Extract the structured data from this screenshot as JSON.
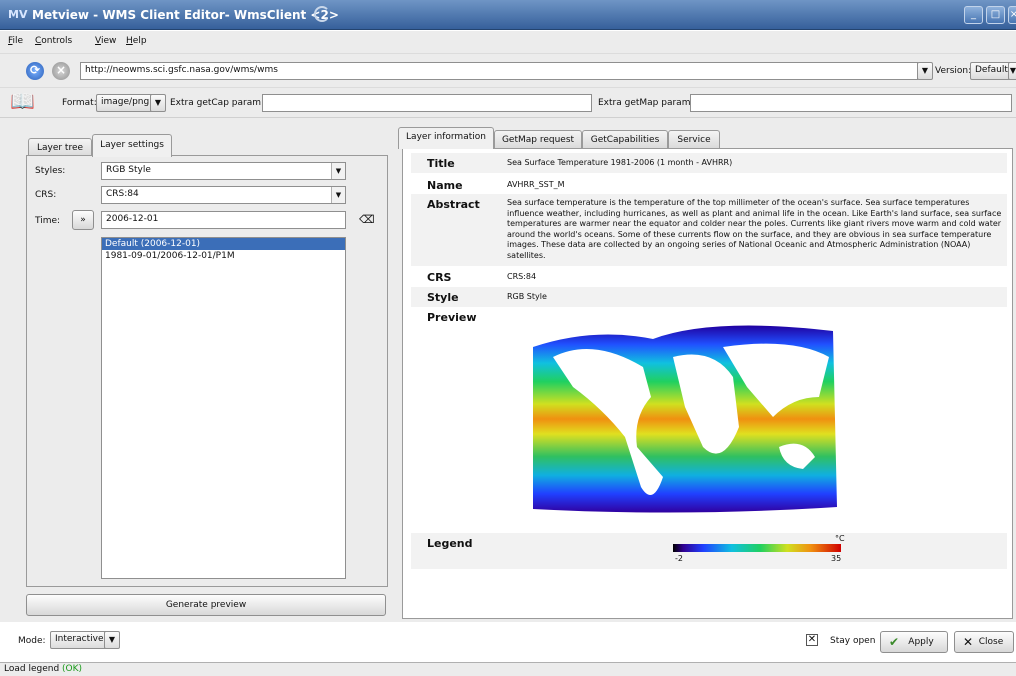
{
  "window": {
    "title": "Metview - WMS Client Editor- WmsClient <2>",
    "app_icon": "MV"
  },
  "menu": [
    "File",
    "Controls",
    "View",
    "Help"
  ],
  "url_bar": {
    "url": "http://neowms.sci.gsfc.nasa.gov/wms/wms",
    "version_label": "Version:",
    "version_value": "Default"
  },
  "format_bar": {
    "format_label": "Format:",
    "format_value": "image/png",
    "extra_getcap_label": "Extra getCap param:",
    "extra_getcap_value": "",
    "extra_getmap_label": "Extra getMap param:",
    "extra_getmap_value": ""
  },
  "left_tabs": [
    "Layer tree",
    "Layer settings"
  ],
  "layer_settings": {
    "styles_label": "Styles:",
    "styles_value": "RGB Style",
    "crs_label": "CRS:",
    "crs_value": "CRS:84",
    "time_label": "Time:",
    "time_button": "»",
    "time_value": "2006-12-01",
    "time_list": [
      "Default (2006-12-01)",
      "1981-09-01/2006-12-01/P1M"
    ],
    "generate_button": "Generate preview"
  },
  "right_tabs": [
    "Layer information",
    "GetMap request",
    "GetCapabilities",
    "Service"
  ],
  "layer_info": {
    "title_key": "Title",
    "title_value": "Sea Surface Temperature 1981-2006 (1 month - AVHRR)",
    "name_key": "Name",
    "name_value": "AVHRR_SST_M",
    "abstract_key": "Abstract",
    "abstract_value": "Sea surface temperature is the temperature of the top millimeter of the ocean's surface. Sea surface temperatures influence weather, including hurricanes, as well as plant and animal life in the ocean. Like Earth's land surface, sea surface temperatures are warmer near the equator and colder near the poles. Currents like giant rivers move warm and cold water around the world's oceans. Some of these currents flow on the surface, and they are obvious in sea surface temperature images. These data are collected by an ongoing series of National Oceanic and Atmospheric Administration (NOAA) satellites.",
    "crs_key": "CRS",
    "crs_value": "CRS:84",
    "style_key": "Style",
    "style_value": "RGB Style",
    "preview_key": "Preview",
    "legend_key": "Legend",
    "legend_unit": "°C",
    "legend_min": "-2",
    "legend_max": "35"
  },
  "bottom": {
    "mode_label": "Mode:",
    "mode_value": "Interactive",
    "stay_open_label": "Stay open",
    "apply_label": "Apply",
    "close_label": "Close"
  },
  "status": {
    "text": "Load legend",
    "ok": "(OK)"
  }
}
